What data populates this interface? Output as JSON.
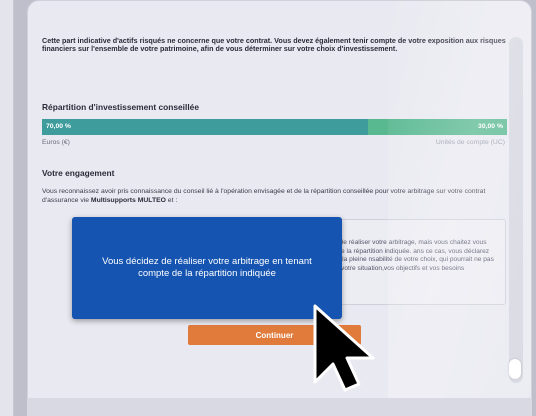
{
  "intro_text": "Cette part indicative d'actifs risqués ne concerne que votre contrat. Vous devez également tenir compte de votre exposition aux risques financiers sur l'ensemble de votre patrimoine, afin de vous déterminer sur votre choix d'investissement.",
  "allocation": {
    "title": "Répartition d'investissement conseillée",
    "left_value": "70,00 %",
    "right_value": "30,00 %",
    "left_fraction": 0.7,
    "right_fraction": 0.3,
    "left_label": "Euros (€)",
    "right_label": "Unités de compte (UC)",
    "colors": {
      "left": "#3e9c9c",
      "right": "#58b890"
    }
  },
  "engagement": {
    "title": "Votre engagement",
    "text_before": "Vous reconnaissez avoir pris connaissance du conseil lié à l'opération envisagée et de la répartition conseillée pour votre arbitrage sur votre contrat d'assurance vie ",
    "contract_name": "Multisupports MULTEO",
    "text_after": " et :"
  },
  "option_text": "décidez de réaliser votre arbitrage, mais vous chaitez vous écarter de la répartition indiquée. ans ce cas, vous déclarez assumer la pleine nsabilité de votre choix, qui pourrait ne pas être té à votre situation,vos objectifs et vos besoins",
  "tooltip_text": "Vous décidez de réaliser votre arbitrage en tenant compte de la répartition indiquée",
  "continue_label": "Continuer",
  "colors": {
    "accent_button": "#e07b3c",
    "tooltip_bg": "#1554b0"
  }
}
